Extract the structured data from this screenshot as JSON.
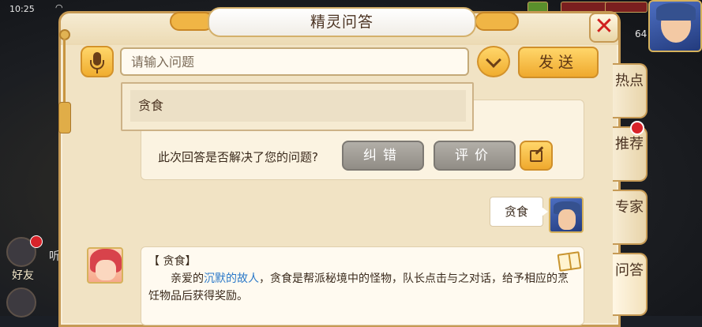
{
  "status_bar": {
    "time": "10:25",
    "level": "64"
  },
  "background": {
    "friend_label": "好友",
    "listen_label": "听"
  },
  "dialog": {
    "title": "精灵问答",
    "input_placeholder": "请输入问题",
    "send_label": "发送",
    "close_icon": "close-icon"
  },
  "suggestions": [
    {
      "label": "贪食"
    }
  ],
  "feedback": {
    "question": "此次回答是否解决了您的问题?",
    "correct_label": "纠错",
    "rate_label": "评价"
  },
  "conversation": {
    "user_message": "贪食",
    "answer_heading": "【 贪食】",
    "answer_prefix": "亲爱的",
    "answer_link": "沉默的故人",
    "answer_suffix": "，贪食是帮派秘境中的怪物，队长点击与之对话，给予相应的烹饪物品后获得奖励。"
  },
  "side_tabs": [
    {
      "label": "热点"
    },
    {
      "label": "推荐"
    },
    {
      "label": "专家"
    },
    {
      "label": "问答"
    }
  ],
  "colors": {
    "panel": "#f1e3c4",
    "accent_gold": "#f0ad2f",
    "close_red": "#d0201e",
    "link_blue": "#2a78c8",
    "badge_red": "#d8232a"
  }
}
